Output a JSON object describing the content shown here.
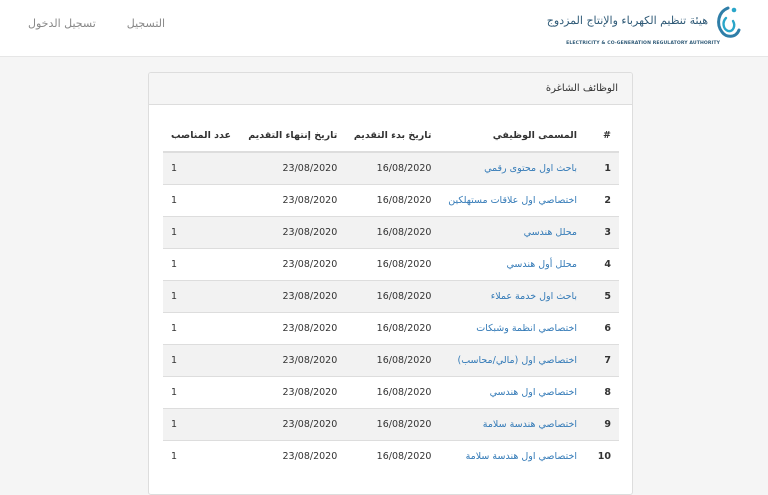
{
  "nav": {
    "login_label": "تسجيل الدخول",
    "register_label": "التسجيل"
  },
  "logo": {
    "arabic_text": "هيئة تنظيم الكهرباء والإنتاج المزدوج",
    "english_text": "ELECTRICITY & CO-GENERATION REGULATORY AUTHORITY"
  },
  "panel": {
    "title": "الوظائف الشاغرة"
  },
  "table": {
    "headers": {
      "num": "#",
      "title": "المسمى الوظيفي",
      "start": "تاريخ بدء التقديم",
      "end": "تاريخ إنتهاء التقديم",
      "positions": "عدد المناصب"
    },
    "rows": [
      {
        "num": "1",
        "title": "باحث اول محتوى رقمي",
        "start": "16/08/2020",
        "end": "23/08/2020",
        "positions": "1"
      },
      {
        "num": "2",
        "title": "اختصاصي اول علاقات مستهلكين",
        "start": "16/08/2020",
        "end": "23/08/2020",
        "positions": "1"
      },
      {
        "num": "3",
        "title": "محلل هندسي",
        "start": "16/08/2020",
        "end": "23/08/2020",
        "positions": "1"
      },
      {
        "num": "4",
        "title": "محلل أول هندسي",
        "start": "16/08/2020",
        "end": "23/08/2020",
        "positions": "1"
      },
      {
        "num": "5",
        "title": "باحث اول خدمة عملاء",
        "start": "16/08/2020",
        "end": "23/08/2020",
        "positions": "1"
      },
      {
        "num": "6",
        "title": "اختصاصي انظمة وشبكات",
        "start": "16/08/2020",
        "end": "23/08/2020",
        "positions": "1"
      },
      {
        "num": "7",
        "title": "اختصاصي اول (مالي/محاسب)",
        "start": "16/08/2020",
        "end": "23/08/2020",
        "positions": "1"
      },
      {
        "num": "8",
        "title": "اختصاصي اول هندسي",
        "start": "16/08/2020",
        "end": "23/08/2020",
        "positions": "1"
      },
      {
        "num": "9",
        "title": "اختصاصي هندسة سلامة",
        "start": "16/08/2020",
        "end": "23/08/2020",
        "positions": "1"
      },
      {
        "num": "10",
        "title": "اختصاصي اول هندسة سلامة",
        "start": "16/08/2020",
        "end": "23/08/2020",
        "positions": "1"
      }
    ]
  },
  "colors": {
    "link": "#337ab7",
    "brand": "#2f5a77",
    "stripe": "#f2f2f2"
  }
}
